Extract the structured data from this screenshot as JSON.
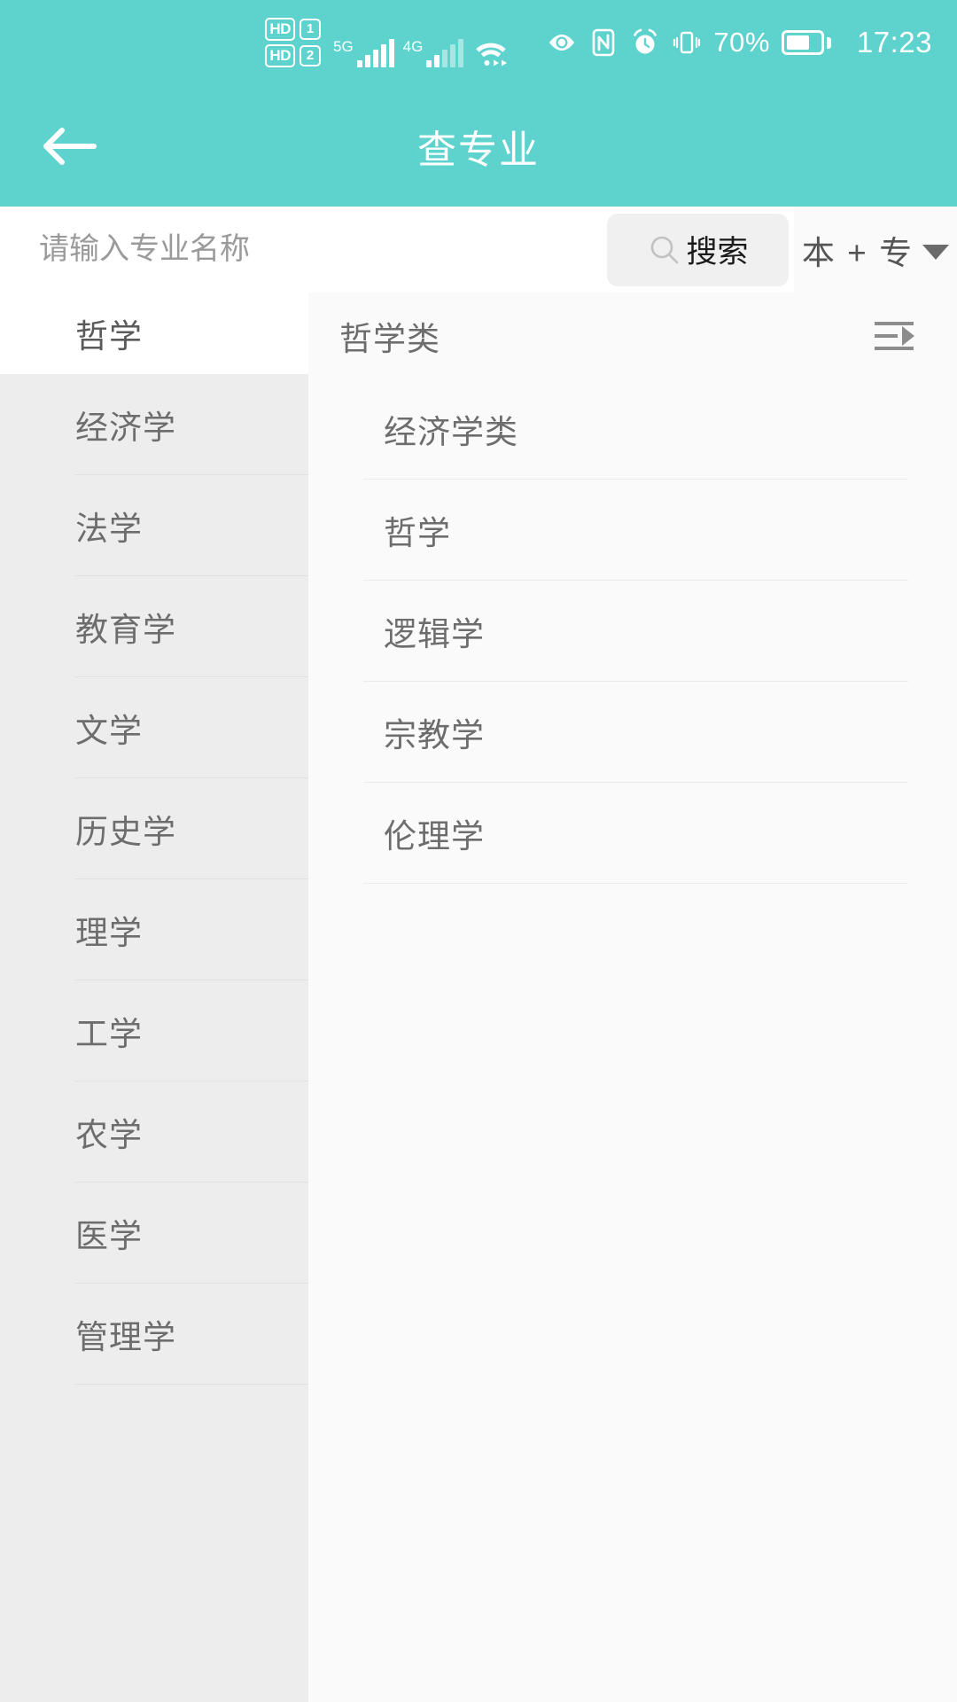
{
  "status_bar": {
    "hd_rows": [
      {
        "hd": "HD",
        "sim": "1"
      },
      {
        "hd": "HD",
        "sim": "2"
      }
    ],
    "signal_1_label": "5G",
    "signal_2_label": "4G",
    "wifi_icon": "wifi-icon",
    "eye_icon": "eye-icon",
    "nfc_icon": "nfc-icon",
    "alarm_icon": "alarm-clock-icon",
    "vibrate_icon": "vibrate-icon",
    "battery_percent": "70%",
    "battery_level": 70,
    "time": "17:23"
  },
  "header": {
    "back_icon": "back-arrow-icon",
    "title": "查专业",
    "background_color": "#5ed3ce",
    "text_color": "#ffffff"
  },
  "search": {
    "placeholder": "请输入专业名称",
    "value": "",
    "button_label": "搜索",
    "button_icon": "search-icon",
    "filter_label": "本 + 专",
    "filter_icon": "chevron-down-icon"
  },
  "sidebar": {
    "items": [
      {
        "label": "哲学",
        "selected": true
      },
      {
        "label": "经济学",
        "selected": false
      },
      {
        "label": "法学",
        "selected": false
      },
      {
        "label": "教育学",
        "selected": false
      },
      {
        "label": "文学",
        "selected": false
      },
      {
        "label": "历史学",
        "selected": false
      },
      {
        "label": "理学",
        "selected": false
      },
      {
        "label": "工学",
        "selected": false
      },
      {
        "label": "农学",
        "selected": false
      },
      {
        "label": "医学",
        "selected": false
      },
      {
        "label": "管理学",
        "selected": false
      }
    ]
  },
  "panel": {
    "header_label": "哲学类",
    "header_icon": "list-expand-icon",
    "items": [
      {
        "label": "经济学类"
      },
      {
        "label": "哲学"
      },
      {
        "label": "逻辑学"
      },
      {
        "label": "宗教学"
      },
      {
        "label": "伦理学"
      }
    ]
  }
}
